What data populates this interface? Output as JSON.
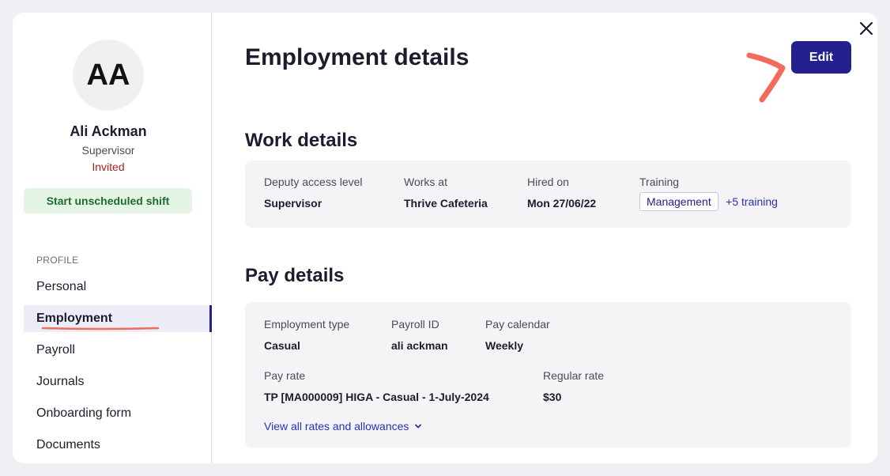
{
  "profile": {
    "initials": "AA",
    "name": "Ali Ackman",
    "role": "Supervisor",
    "status": "Invited",
    "shift_button": "Start unscheduled shift"
  },
  "nav": {
    "section_label": "PROFILE",
    "items": [
      {
        "label": "Personal"
      },
      {
        "label": "Employment"
      },
      {
        "label": "Payroll"
      },
      {
        "label": "Journals"
      },
      {
        "label": "Onboarding form"
      },
      {
        "label": "Documents"
      }
    ],
    "active": "Employment"
  },
  "main": {
    "title": "Employment details",
    "edit_label": "Edit",
    "work": {
      "heading": "Work details",
      "access_label": "Deputy access level",
      "access_value": "Supervisor",
      "works_at_label": "Works at",
      "works_at_value": "Thrive Cafeteria",
      "hired_label": "Hired on",
      "hired_value": "Mon 27/06/22",
      "training_label": "Training",
      "training_chip": "Management",
      "training_more": "+5 training"
    },
    "pay": {
      "heading": "Pay details",
      "type_label": "Employment type",
      "type_value": "Casual",
      "payroll_id_label": "Payroll ID",
      "payroll_id_value": "ali ackman",
      "calendar_label": "Pay calendar",
      "calendar_value": "Weekly",
      "rate_label": "Pay rate",
      "rate_value": "TP [MA000009] HIGA - Casual - 1-July-2024",
      "regular_label": "Regular rate",
      "regular_value": "$30",
      "view_all_link": "View all rates and allowances"
    }
  },
  "icons": {
    "close": "close-icon",
    "chevron": "chevron-down-icon"
  },
  "colors": {
    "primary": "#24208f",
    "invited": "#b01d1d",
    "shift_bg": "#e4f5e6",
    "shift_text": "#1f6b2e",
    "annotation": "#f26b5b"
  }
}
